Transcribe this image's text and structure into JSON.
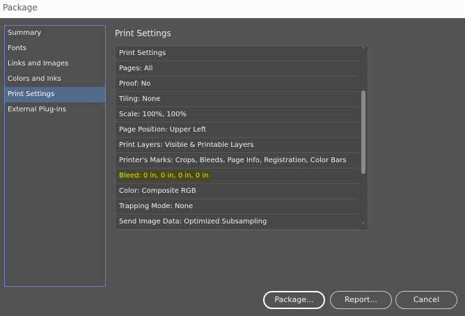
{
  "window": {
    "title": "Package"
  },
  "sidebar": {
    "items": [
      {
        "label": "Summary",
        "active": false
      },
      {
        "label": "Fonts",
        "active": false
      },
      {
        "label": "Links and Images",
        "active": false
      },
      {
        "label": "Colors and Inks",
        "active": false
      },
      {
        "label": "Print Settings",
        "active": true
      },
      {
        "label": "External Plug-ins",
        "active": false
      }
    ]
  },
  "main": {
    "heading": "Print Settings",
    "rows": [
      "Print Settings",
      "Pages: All",
      "Proof: No",
      "Tiling: None",
      "Scale: 100%, 100%",
      "Page Position: Upper Left",
      "Print Layers: Visible & Printable Layers",
      "Printer's Marks: Crops, Bleeds, Page Info, Registration, Color Bars",
      "Bleed: 0 in, 0 in, 0 in, 0 in",
      "Color: Composite RGB",
      "Trapping Mode: None",
      "Send Image Data: Optimized Subsampling"
    ],
    "highlighted_row": "Bleed: 0 in, 0 in, 0 in, 0 in"
  },
  "buttons": {
    "package": "Package...",
    "report": "Report...",
    "cancel": "Cancel"
  },
  "colors": {
    "highlight_text": "#e0e016",
    "selection": "#526a8c",
    "background": "#535353"
  }
}
